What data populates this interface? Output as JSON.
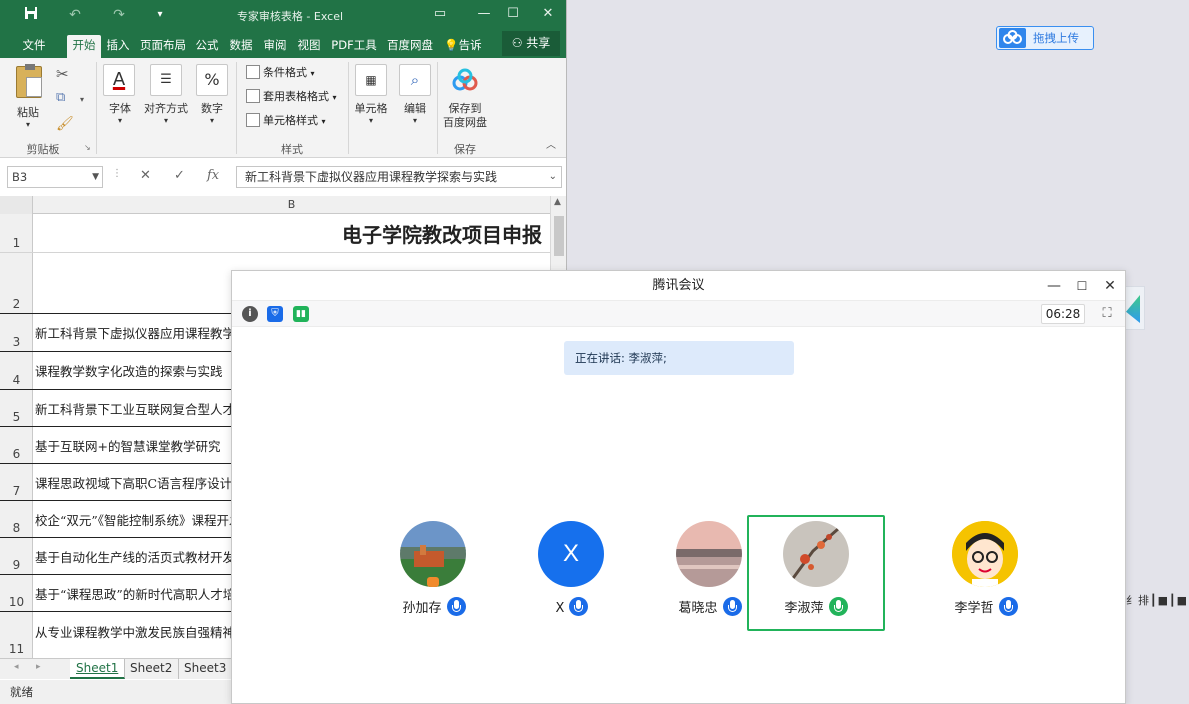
{
  "excel": {
    "title": "专家审核表格 - Excel",
    "quick_access": {
      "save_icon": "save-icon",
      "undo_icon": "undo-icon",
      "redo_icon": "redo-icon",
      "customize_icon": "customize-icon"
    },
    "tabs": [
      {
        "label": "文件"
      },
      {
        "label": "开始",
        "active": true
      },
      {
        "label": "插入"
      },
      {
        "label": "页面布局"
      },
      {
        "label": "公式"
      },
      {
        "label": "数据"
      },
      {
        "label": "审阅"
      },
      {
        "label": "视图"
      },
      {
        "label": "PDF工具"
      },
      {
        "label": "百度网盘"
      },
      {
        "label": "告诉"
      }
    ],
    "share_label": "共享",
    "ribbon": {
      "paste": "粘贴",
      "clipboard_group": "剪贴板",
      "font": "字体",
      "align": "对齐方式",
      "number": "数字",
      "cond_format": "条件格式",
      "table_format": "套用表格格式",
      "cell_style": "单元格样式",
      "styles_group": "样式",
      "cells": "单元格",
      "edit": "编辑",
      "save_baidu_l1": "保存到",
      "save_baidu_l2": "百度网盘",
      "save_group": "保存"
    },
    "name_box": "B3",
    "fx": "fx",
    "formula": "新工科背景下虚拟仪器应用课程教学探索与实践",
    "column_b": "B",
    "rows": [
      {
        "num": "1",
        "text": "电子学院教改项目申报"
      },
      {
        "num": "2",
        "text": ""
      },
      {
        "num": "3",
        "text": "新工科背景下虚拟仪器应用课程教学探索与实践"
      },
      {
        "num": "4",
        "text": "课程教学数字化改造的探索与实践"
      },
      {
        "num": "5",
        "text": "新工科背景下工业互联网复合型人才培养研究"
      },
      {
        "num": "6",
        "text": "基于互联网+的智慧课堂教学研究"
      },
      {
        "num": "7",
        "text": "课程思政视域下高职C语言程序设计"
      },
      {
        "num": "8",
        "text": "校企“双元”《智能控制系统》课程开发"
      },
      {
        "num": "9",
        "text": "基于自动化生产线的活页式教材开发"
      },
      {
        "num": "10",
        "text": "基于“课程思政”的新时代高职人才培养"
      },
      {
        "num": "11",
        "text": "从专业课程教学中激发民族自强精神"
      }
    ],
    "sheets": [
      "Sheet1",
      "Sheet2",
      "Sheet3"
    ],
    "status": "就绪"
  },
  "upload": {
    "label": "拖拽上传"
  },
  "side_ruler": "纟排┃■┃■",
  "meeting": {
    "title": "腾讯会议",
    "timer": "06:28",
    "speaking": "正在讲话: 李淑萍;",
    "participants": [
      {
        "name": "孙加存",
        "speaking": false
      },
      {
        "name": "X",
        "initial": "X",
        "speaking": false
      },
      {
        "name": "葛晓忠",
        "speaking": false
      },
      {
        "name": "李淑萍",
        "speaking": true
      },
      {
        "name": "李学哲",
        "speaking": false
      }
    ]
  }
}
